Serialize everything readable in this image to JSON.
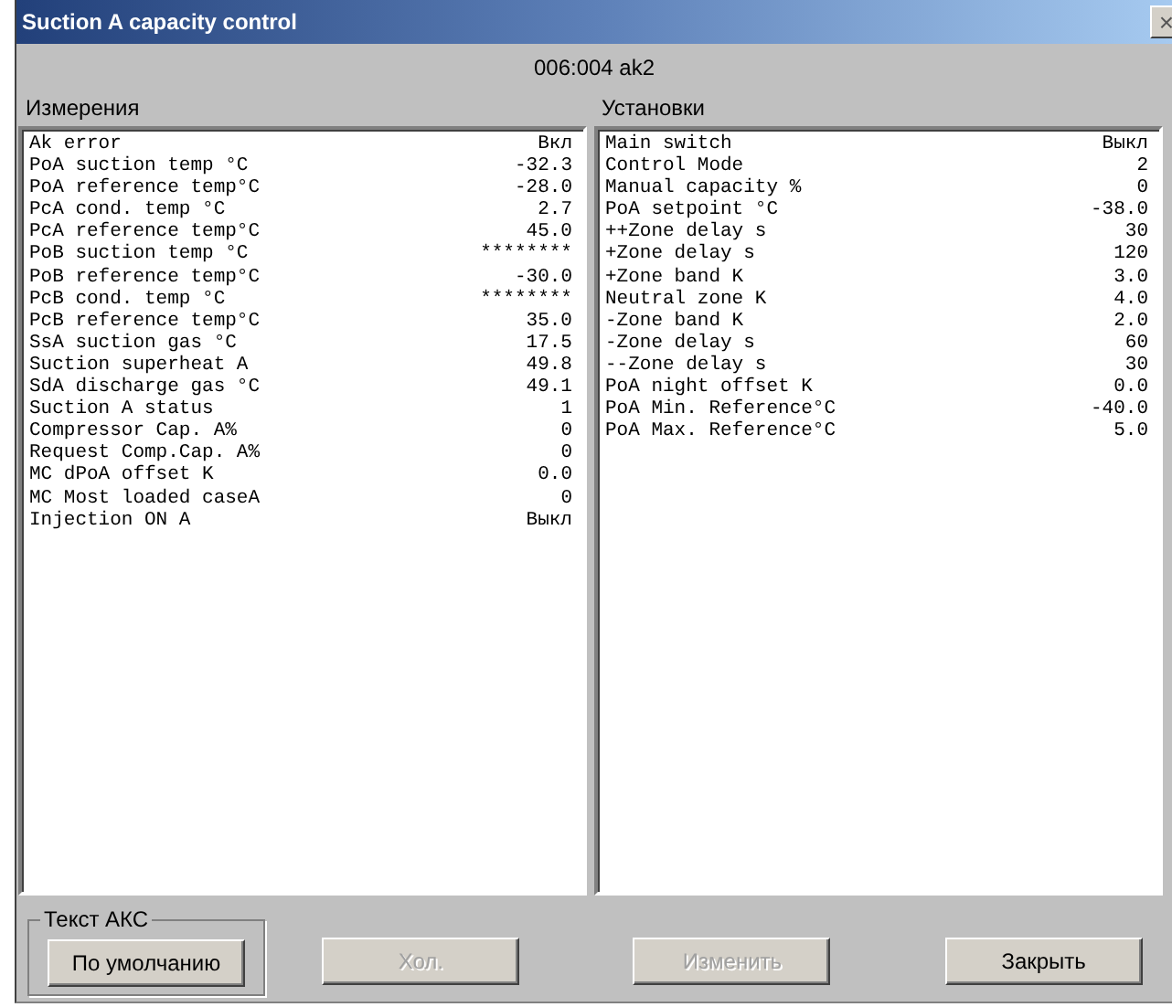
{
  "window": {
    "title": "Suction A capacity control",
    "close": "×"
  },
  "device": "006:004  ak2",
  "measurements": {
    "title": "Измерения",
    "rows": [
      {
        "name": "Ak error",
        "value": "Вкл"
      },
      {
        "name": "PoA suction temp °C",
        "value": "-32.3"
      },
      {
        "name": "PoA reference temp°C",
        "value": "-28.0"
      },
      {
        "name": "PcA cond. temp °C",
        "value": "2.7"
      },
      {
        "name": "PcA reference temp°C",
        "value": "45.0"
      },
      {
        "name": "PoB suction temp °C",
        "value": "********"
      },
      {
        "name": "PoB reference temp°C",
        "value": "-30.0"
      },
      {
        "name": "PcB cond. temp °C",
        "value": "********"
      },
      {
        "name": "PcB reference temp°C",
        "value": "35.0"
      },
      {
        "name": "SsA suction gas °C",
        "value": "17.5"
      },
      {
        "name": "Suction superheat A",
        "value": "49.8"
      },
      {
        "name": "SdA discharge gas °C",
        "value": "49.1"
      },
      {
        "name": "Suction A status",
        "value": "1"
      },
      {
        "name": "Compressor Cap. A%",
        "value": "0"
      },
      {
        "name": "Request Comp.Cap. A%",
        "value": "0"
      },
      {
        "name": "MC dPoA offset K",
        "value": "0.0"
      },
      {
        "name": "MC Most loaded caseA",
        "value": "0"
      },
      {
        "name": "Injection ON A",
        "value": "Выкл"
      }
    ]
  },
  "settings": {
    "title": "Установки",
    "rows": [
      {
        "name": "Main switch",
        "value": "Выкл"
      },
      {
        "name": "Control Mode",
        "value": "2"
      },
      {
        "name": "Manual capacity %",
        "value": "0"
      },
      {
        "name": "PoA setpoint °C",
        "value": "-38.0"
      },
      {
        "name": "++Zone delay s",
        "value": "30"
      },
      {
        "name": "+Zone delay s",
        "value": "120"
      },
      {
        "name": "+Zone band K",
        "value": "3.0"
      },
      {
        "name": "Neutral zone K",
        "value": "4.0"
      },
      {
        "name": "-Zone band K",
        "value": "2.0"
      },
      {
        "name": "-Zone delay s",
        "value": "60"
      },
      {
        "name": "--Zone delay s",
        "value": "30"
      },
      {
        "name": "PoA night offset K",
        "value": "0.0"
      },
      {
        "name": "PoA Min. Reference°C",
        "value": "-40.0"
      },
      {
        "name": "PoA Max. Reference°C",
        "value": "5.0"
      }
    ]
  },
  "group": {
    "title": "Текст АКС",
    "button": {
      "label": "По умолчанию",
      "disabled": false
    }
  },
  "buttons": [
    {
      "label": "Хол.",
      "disabled": true
    },
    {
      "label": "Изменить",
      "disabled": true
    },
    {
      "label": "Закрыть",
      "disabled": false
    }
  ]
}
